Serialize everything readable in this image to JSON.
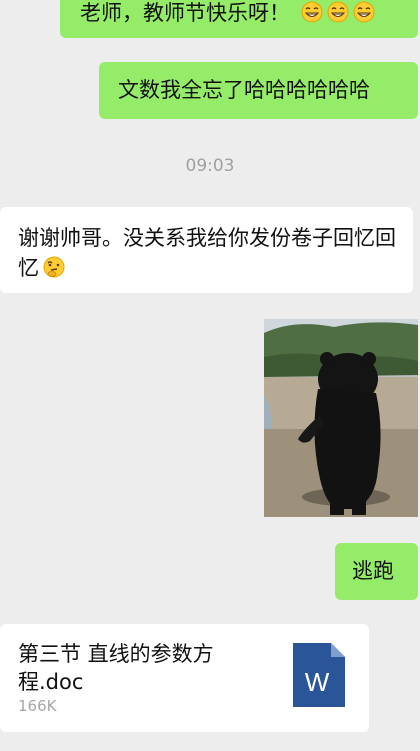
{
  "messages": {
    "m1": "老师，教师节快乐呀！",
    "m2": "文数我全忘了哈哈哈哈哈哈",
    "timestamp": "09:03",
    "m3": "谢谢帅哥。没关系我给你发份卷子回忆回忆",
    "m4": "逃跑"
  },
  "file": {
    "name": "第三节 直线的参数方程.doc",
    "size": "166K",
    "icon_letter": "W",
    "icon_color": "#2a5699"
  },
  "colors": {
    "background": "#ededed",
    "sent_bubble": "#95ec69",
    "received_bubble": "#ffffff"
  },
  "icons": [
    "grin-emoji-icon",
    "thinking-emoji-icon",
    "word-doc-icon"
  ]
}
